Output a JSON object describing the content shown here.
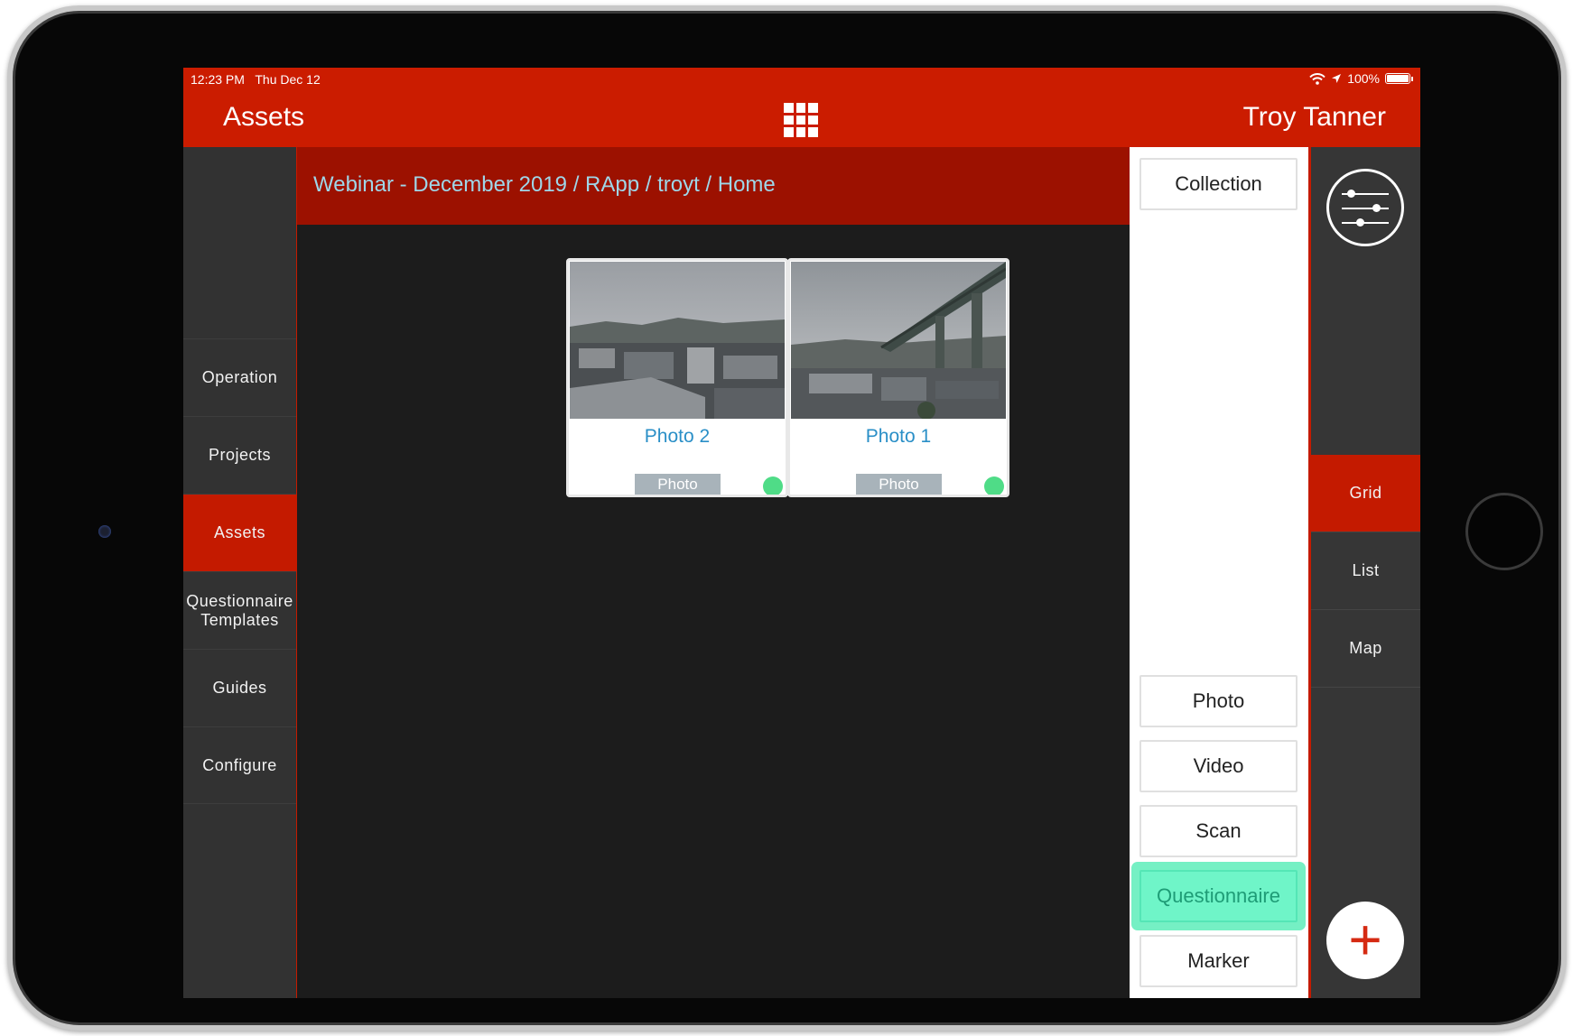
{
  "status_bar": {
    "time": "12:23 PM",
    "date": "Thu Dec 12",
    "battery": "100%",
    "wifi_icon": "wifi-icon",
    "location_icon": "location-arrow-icon"
  },
  "nav": {
    "title": "Assets",
    "user": "Troy Tanner",
    "center_icon": "grid-icon"
  },
  "sidebar": {
    "items": [
      {
        "label": "Operation",
        "active": false
      },
      {
        "label": "Projects",
        "active": false
      },
      {
        "label": "Assets",
        "active": true
      },
      {
        "label": "Questionnaire Templates",
        "active": false
      },
      {
        "label": "Guides",
        "active": false
      },
      {
        "label": "Configure",
        "active": false
      }
    ]
  },
  "breadcrumb": "Webinar - December 2019 / RApp / troyt / Home",
  "assets": [
    {
      "title": "Photo 2",
      "type": "Photo",
      "status_color": "#4fdc87"
    },
    {
      "title": "Photo 1",
      "type": "Photo",
      "status_color": "#4fdc87"
    }
  ],
  "action_panel": {
    "top_button": "Collection",
    "buttons": [
      "Photo",
      "Video",
      "Scan",
      "Questionnaire",
      "Marker"
    ],
    "highlighted": "Questionnaire"
  },
  "right_rail": {
    "filter_icon": "filter-sliders-icon",
    "views": [
      {
        "label": "Grid",
        "active": true
      },
      {
        "label": "List",
        "active": false
      },
      {
        "label": "Map",
        "active": false
      }
    ],
    "add_icon": "plus-icon"
  },
  "colors": {
    "brand_red": "#cb1c00",
    "breadcrumb_bg": "#9c1100",
    "link_blue": "#9fd6e8",
    "highlight_green": "#6ff5c8"
  }
}
